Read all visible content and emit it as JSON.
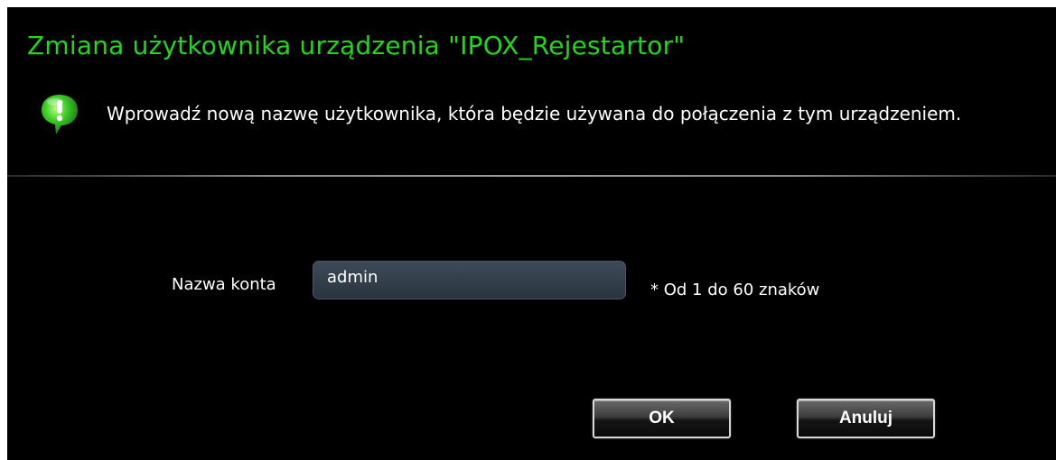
{
  "dialog": {
    "title": "Zmiana użytkownika urządzenia \"IPOX_Rejestartor\"",
    "hint_icon": "exclamation-speech-bubble-icon",
    "hint_text": "Wprowadź nową nazwę użytkownika, która będzie używana do połączenia z tym urządzeniem.",
    "field_label": "Nazwa konta",
    "field_value": "admin",
    "field_note": "* Od 1 do 60 znaków",
    "ok_label": "OK",
    "cancel_label": "Anuluj"
  },
  "colors": {
    "background": "#000000",
    "title": "#22d61e",
    "icon_green": "#3fcf2a",
    "text": "#ffffff"
  }
}
